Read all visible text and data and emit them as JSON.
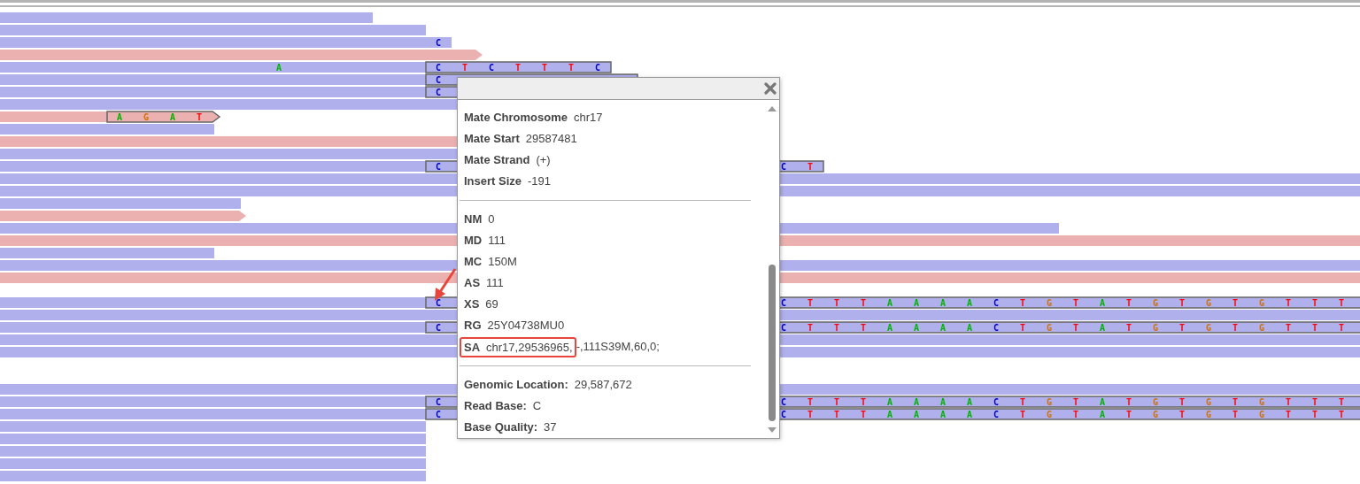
{
  "alignments": [
    {
      "kind": "reverse"
    },
    {
      "kind": "reverse"
    },
    {
      "kind": "reverse",
      "bases": [
        {
          "base": "C",
          "color": "#0000c8"
        }
      ]
    },
    {
      "kind": "forward"
    },
    {
      "kind": "reverse",
      "bases": [
        {
          "base": "A",
          "color": "#00b400"
        },
        {
          "base": "C",
          "color": "#0000c8"
        },
        {
          "base": "T",
          "color": "#ff0000"
        },
        {
          "base": "C",
          "color": "#0000c8"
        },
        {
          "base": "T",
          "color": "#ff0000"
        },
        {
          "base": "T",
          "color": "#ff0000"
        },
        {
          "base": "T",
          "color": "#ff0000"
        },
        {
          "base": "C",
          "color": "#0000c8"
        }
      ]
    },
    {
      "kind": "reverse",
      "bases": [
        {
          "base": "C",
          "color": "#0000c8"
        }
      ]
    },
    {
      "kind": "reverse",
      "bases": [
        {
          "base": "C",
          "color": "#0000c8"
        }
      ]
    },
    {
      "kind": "reverse"
    },
    {
      "kind": "forward",
      "bases": [
        {
          "base": "A",
          "color": "#00b400"
        },
        {
          "base": "G",
          "color": "#d17105"
        },
        {
          "base": "A",
          "color": "#00b400"
        },
        {
          "base": "T",
          "color": "#ff0000"
        }
      ]
    },
    {
      "kind": "reverse"
    },
    {
      "kind": "forward"
    },
    {
      "kind": "reverse"
    },
    {
      "kind": "reverse",
      "bases": [
        {
          "base": "C",
          "color": "#0000c8"
        },
        {
          "base": "C",
          "color": "#0000c8"
        },
        {
          "base": "T",
          "color": "#ff0000"
        }
      ]
    },
    {
      "kind": "reverse"
    },
    {
      "kind": "reverse"
    },
    {
      "kind": "reverse"
    },
    {
      "kind": "forward"
    },
    {
      "kind": "reverse"
    },
    {
      "kind": "forward"
    },
    {
      "kind": "reverse"
    },
    {
      "kind": "reverse"
    },
    {
      "kind": "forward"
    },
    {
      "kind": "reverse",
      "bases": [
        {
          "base": "C",
          "color": "#0000c8"
        },
        {
          "base": "C",
          "color": "#0000c8"
        },
        {
          "base": "T",
          "color": "#ff0000"
        },
        {
          "base": "T",
          "color": "#ff0000"
        },
        {
          "base": "T",
          "color": "#ff0000"
        },
        {
          "base": "A",
          "color": "#00b400"
        },
        {
          "base": "A",
          "color": "#00b400"
        },
        {
          "base": "A",
          "color": "#00b400"
        },
        {
          "base": "A",
          "color": "#00b400"
        },
        {
          "base": "C",
          "color": "#0000c8"
        },
        {
          "base": "T",
          "color": "#ff0000"
        },
        {
          "base": "G",
          "color": "#d17105"
        },
        {
          "base": "T",
          "color": "#ff0000"
        },
        {
          "base": "A",
          "color": "#00b400"
        },
        {
          "base": "T",
          "color": "#ff0000"
        },
        {
          "base": "G",
          "color": "#d17105"
        },
        {
          "base": "T",
          "color": "#ff0000"
        },
        {
          "base": "G",
          "color": "#d17105"
        },
        {
          "base": "T",
          "color": "#ff0000"
        },
        {
          "base": "G",
          "color": "#d17105"
        },
        {
          "base": "T",
          "color": "#ff0000"
        },
        {
          "base": "T",
          "color": "#ff0000"
        },
        {
          "base": "T",
          "color": "#ff0000"
        }
      ]
    },
    {
      "kind": "reverse"
    },
    {
      "kind": "reverse",
      "bases": [
        {
          "base": "C",
          "color": "#0000c8"
        },
        {
          "base": "C",
          "color": "#0000c8"
        },
        {
          "base": "T",
          "color": "#ff0000"
        },
        {
          "base": "T",
          "color": "#ff0000"
        },
        {
          "base": "T",
          "color": "#ff0000"
        },
        {
          "base": "A",
          "color": "#00b400"
        },
        {
          "base": "A",
          "color": "#00b400"
        },
        {
          "base": "A",
          "color": "#00b400"
        },
        {
          "base": "A",
          "color": "#00b400"
        },
        {
          "base": "C",
          "color": "#0000c8"
        },
        {
          "base": "T",
          "color": "#ff0000"
        },
        {
          "base": "G",
          "color": "#d17105"
        },
        {
          "base": "T",
          "color": "#ff0000"
        },
        {
          "base": "A",
          "color": "#00b400"
        },
        {
          "base": "T",
          "color": "#ff0000"
        },
        {
          "base": "G",
          "color": "#d17105"
        },
        {
          "base": "T",
          "color": "#ff0000"
        },
        {
          "base": "G",
          "color": "#d17105"
        },
        {
          "base": "T",
          "color": "#ff0000"
        },
        {
          "base": "G",
          "color": "#d17105"
        },
        {
          "base": "T",
          "color": "#ff0000"
        },
        {
          "base": "T",
          "color": "#ff0000"
        },
        {
          "base": "T",
          "color": "#ff0000"
        }
      ]
    },
    {
      "kind": "reverse"
    },
    {
      "kind": "reverse"
    },
    {
      "kind": "reverse"
    },
    {
      "kind": "reverse",
      "bases": [
        {
          "base": "C",
          "color": "#0000c8"
        },
        {
          "base": "C",
          "color": "#0000c8"
        },
        {
          "base": "T",
          "color": "#ff0000"
        },
        {
          "base": "T",
          "color": "#ff0000"
        },
        {
          "base": "T",
          "color": "#ff0000"
        },
        {
          "base": "A",
          "color": "#00b400"
        },
        {
          "base": "A",
          "color": "#00b400"
        },
        {
          "base": "A",
          "color": "#00b400"
        },
        {
          "base": "A",
          "color": "#00b400"
        },
        {
          "base": "C",
          "color": "#0000c8"
        },
        {
          "base": "T",
          "color": "#ff0000"
        },
        {
          "base": "G",
          "color": "#d17105"
        },
        {
          "base": "T",
          "color": "#ff0000"
        },
        {
          "base": "A",
          "color": "#00b400"
        },
        {
          "base": "T",
          "color": "#ff0000"
        },
        {
          "base": "G",
          "color": "#d17105"
        },
        {
          "base": "T",
          "color": "#ff0000"
        },
        {
          "base": "G",
          "color": "#d17105"
        },
        {
          "base": "T",
          "color": "#ff0000"
        },
        {
          "base": "G",
          "color": "#d17105"
        },
        {
          "base": "T",
          "color": "#ff0000"
        },
        {
          "base": "T",
          "color": "#ff0000"
        },
        {
          "base": "T",
          "color": "#ff0000"
        }
      ]
    },
    {
      "kind": "reverse",
      "bases": [
        {
          "base": "C",
          "color": "#0000c8"
        },
        {
          "base": "C",
          "color": "#0000c8"
        },
        {
          "base": "T",
          "color": "#ff0000"
        },
        {
          "base": "T",
          "color": "#ff0000"
        },
        {
          "base": "T",
          "color": "#ff0000"
        },
        {
          "base": "A",
          "color": "#00b400"
        },
        {
          "base": "A",
          "color": "#00b400"
        },
        {
          "base": "A",
          "color": "#00b400"
        },
        {
          "base": "A",
          "color": "#00b400"
        },
        {
          "base": "C",
          "color": "#0000c8"
        },
        {
          "base": "T",
          "color": "#ff0000"
        },
        {
          "base": "G",
          "color": "#d17105"
        },
        {
          "base": "T",
          "color": "#ff0000"
        },
        {
          "base": "A",
          "color": "#00b400"
        },
        {
          "base": "T",
          "color": "#ff0000"
        },
        {
          "base": "G",
          "color": "#d17105"
        },
        {
          "base": "T",
          "color": "#ff0000"
        },
        {
          "base": "G",
          "color": "#d17105"
        },
        {
          "base": "T",
          "color": "#ff0000"
        },
        {
          "base": "G",
          "color": "#d17105"
        },
        {
          "base": "T",
          "color": "#ff0000"
        },
        {
          "base": "T",
          "color": "#ff0000"
        },
        {
          "base": "T",
          "color": "#ff0000"
        }
      ]
    },
    {
      "kind": "reverse"
    },
    {
      "kind": "reverse"
    },
    {
      "kind": "reverse"
    },
    {
      "kind": "reverse"
    },
    {
      "kind": "reverse"
    }
  ],
  "popup": {
    "sections": [
      {
        "rows": [
          {
            "label": "Mate Chromosome",
            "value": "chr17"
          },
          {
            "label": "Mate Start",
            "value": "29587481"
          },
          {
            "label": "Mate Strand",
            "value": "(+)"
          },
          {
            "label": "Insert Size",
            "value": "-191"
          }
        ]
      },
      {
        "rows": [
          {
            "label": "NM",
            "value": "0"
          },
          {
            "label": "MD",
            "value": "111"
          },
          {
            "label": "MC",
            "value": "150M"
          },
          {
            "label": "AS",
            "value": "111"
          },
          {
            "label": "XS",
            "value": "69"
          },
          {
            "label": "RG",
            "value": "25Y04738MU0"
          },
          {
            "label": "SA",
            "highlighted_value": "chr17,29536965,",
            "value": "-,111S39M,60,0;"
          }
        ]
      },
      {
        "rows": [
          {
            "label": "Genomic Location:",
            "value": "29,587,672"
          },
          {
            "label": "Read Base:",
            "value": "C"
          },
          {
            "label": "Base Quality:",
            "value": "37"
          }
        ]
      }
    ]
  }
}
